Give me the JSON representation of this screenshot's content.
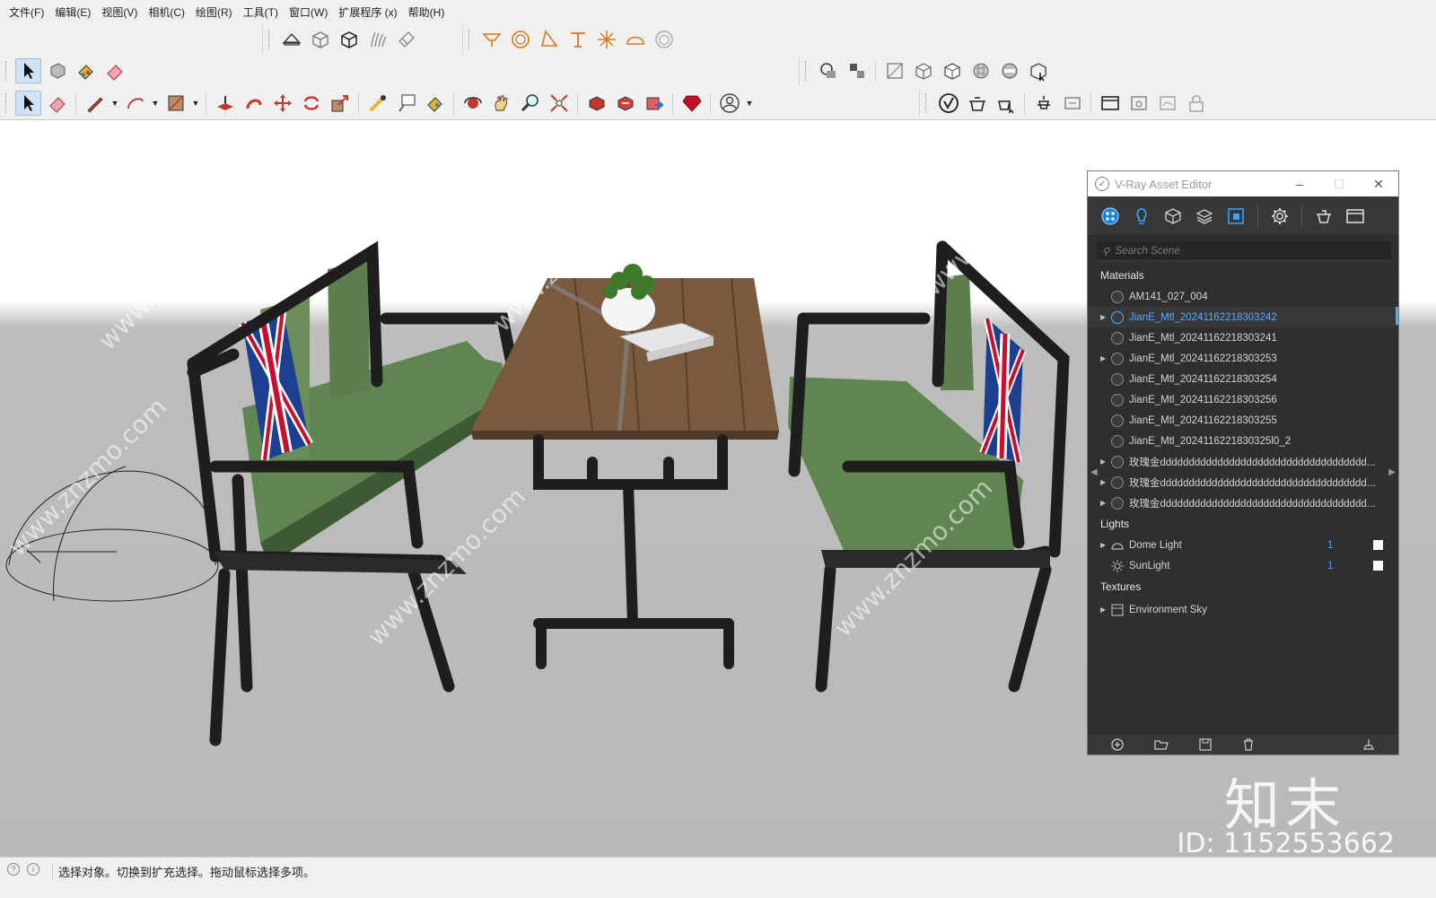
{
  "menu": [
    "文件(F)",
    "编辑(E)",
    "视图(V)",
    "相机(C)",
    "绘图(R)",
    "工具(T)",
    "窗口(W)",
    "扩展程序 (x)",
    "帮助(H)"
  ],
  "vray": {
    "title": "V-Ray Asset Editor",
    "search_placeholder": "Search Scene",
    "sections": {
      "materials": "Materials",
      "lights": "Lights",
      "textures": "Textures"
    },
    "materials": [
      {
        "name": "AM141_027_004",
        "expandable": false,
        "selected": false
      },
      {
        "name": "JianE_Mtl_20241162218303242",
        "expandable": true,
        "selected": true
      },
      {
        "name": "JianE_Mtl_20241162218303241",
        "expandable": false,
        "selected": false
      },
      {
        "name": "JianE_Mtl_20241162218303253",
        "expandable": true,
        "selected": false
      },
      {
        "name": "JianE_Mtl_20241162218303254",
        "expandable": false,
        "selected": false
      },
      {
        "name": "JianE_Mtl_20241162218303256",
        "expandable": false,
        "selected": false
      },
      {
        "name": "JianE_Mtl_20241162218303255",
        "expandable": false,
        "selected": false
      },
      {
        "name": "JianE_Mtl_2024116221830325l0_2",
        "expandable": false,
        "selected": false
      },
      {
        "name": "玫瑰金dddddddddddddddddddddddddddddddddddd...",
        "expandable": true,
        "selected": false
      },
      {
        "name": "玫瑰金dddddddddddddddddddddddddddddddddddd...",
        "expandable": true,
        "selected": false
      },
      {
        "name": "玫瑰金dddddddddddddddddddddddddddddddddddd...",
        "expandable": true,
        "selected": false
      }
    ],
    "lights": [
      {
        "name": "Dome Light",
        "icon": "dome-light-icon",
        "count": "1"
      },
      {
        "name": "SunLight",
        "icon": "sun-icon",
        "count": "1"
      }
    ],
    "textures": [
      {
        "name": "Environment Sky",
        "icon": "texture-icon"
      }
    ]
  },
  "watermark": {
    "site": "www.znzmo.com",
    "brand": "知末",
    "id": "ID: 1152553662"
  },
  "status": {
    "text": "选择对象。切换到扩充选择。拖动鼠标选择多项。"
  },
  "colors": {
    "vray_bg": "#2f2f2f",
    "vray_accent": "#57a9ff",
    "seat_green": "#5f8550",
    "frame_black": "#1e1e1e",
    "wood": "#7a5a3c",
    "toolbar_bg": "#f0f0f0"
  }
}
